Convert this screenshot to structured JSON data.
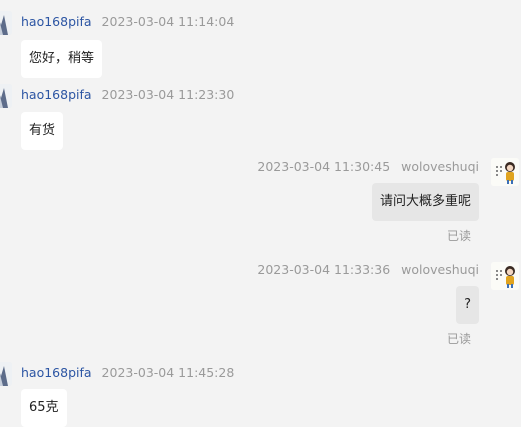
{
  "colors": {
    "background": "#f3f3f3",
    "incoming_bubble": "#ffffff",
    "outgoing_bubble": "#e6e6e6",
    "sender_name": "#2c55a3",
    "meta_text": "#9a9a9a"
  },
  "messages": [
    {
      "direction": "incoming",
      "sender": "hao168pifa",
      "time": "2023-03-04 11:14:04",
      "text": "您好，稍等"
    },
    {
      "direction": "incoming",
      "sender": "hao168pifa",
      "time": "2023-03-04 11:23:30",
      "text": "有货"
    },
    {
      "direction": "outgoing",
      "sender": "woloveshuqi",
      "time": "2023-03-04 11:30:45",
      "text": "请问大概多重呢",
      "status": "已读"
    },
    {
      "direction": "outgoing",
      "sender": "woloveshuqi",
      "time": "2023-03-04 11:33:36",
      "text": "?",
      "status": "已读"
    },
    {
      "direction": "incoming",
      "sender": "hao168pifa",
      "time": "2023-03-04 11:45:28",
      "text": "65克"
    }
  ]
}
